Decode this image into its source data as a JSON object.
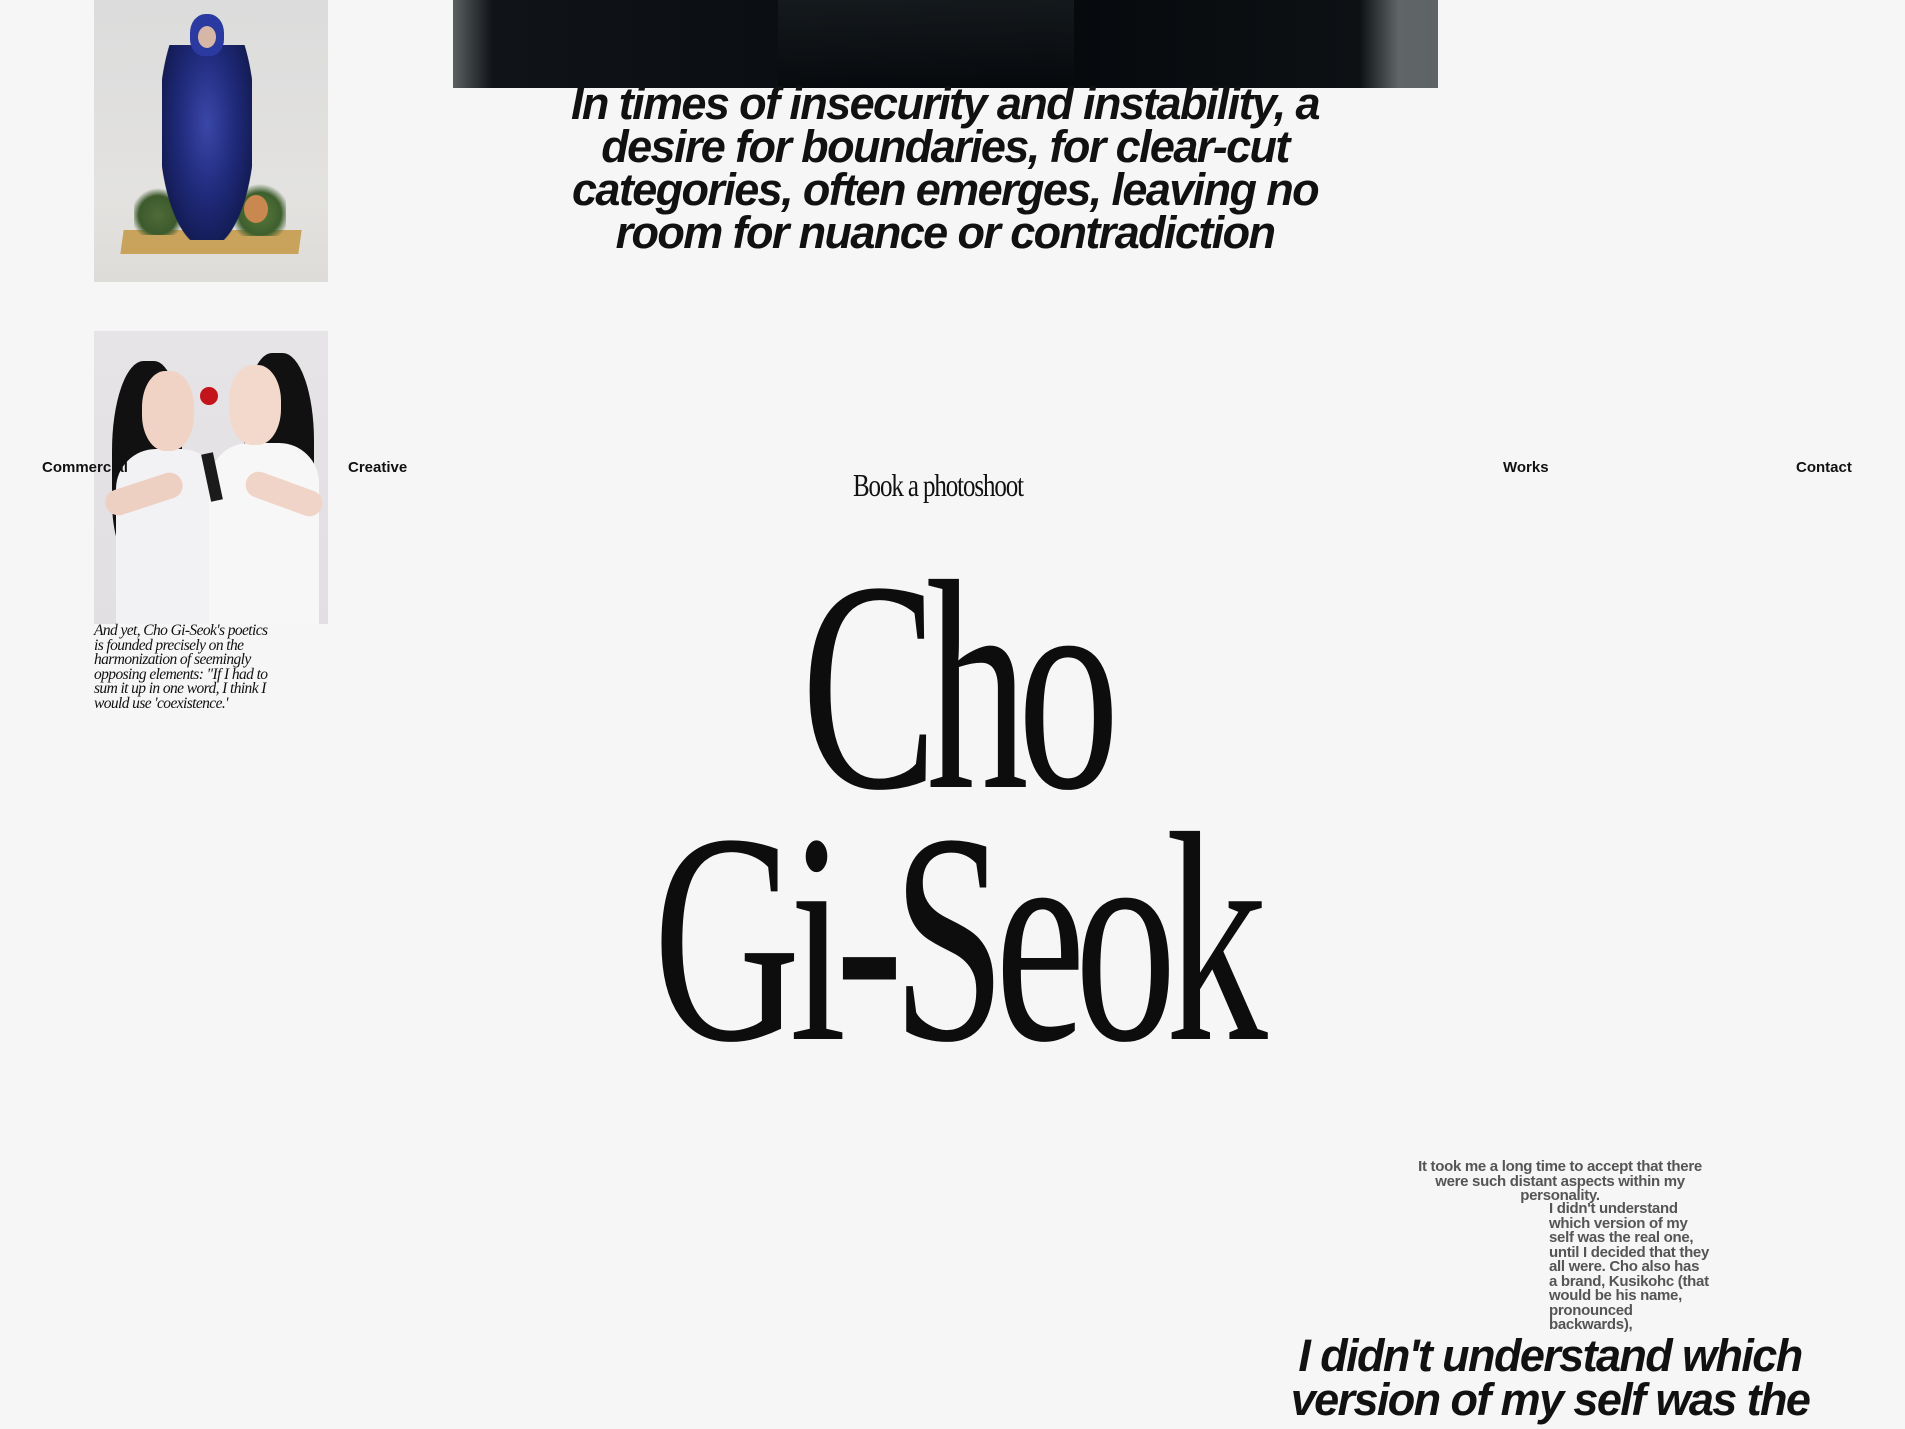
{
  "quotes": {
    "top": "In times of insecurity and instability, a desire for boundaries, for clear-cut categories, often emerges, leaving no room for nuance or contradiction",
    "bottom": "I didn't understand which version of my self was the"
  },
  "nav": {
    "commercial": "Commercial",
    "creative": "Creative",
    "book": "Book a photoshoot",
    "works": "Works",
    "contact": "Contact"
  },
  "captions": {
    "left": "And yet, Cho Gi-Seok's poetics is founded precisely on the harmonization of seemingly opposing elements: \"If I had to sum it up in one word, I think I would use 'coexistence.'",
    "right_a": "It took me a long time to accept that there were such distant aspects within my personality.",
    "right_b": "I didn't understand which version of my self was the real one, until I decided that they all were. Cho also has a brand, Kusikohc (that would be his name, pronounced backwards),"
  },
  "hero": {
    "line1": "Cho",
    "line2": "Gi-Seok"
  },
  "colors": {
    "background": "#f6f6f6",
    "text": "#111111",
    "muted_text": "#555555"
  }
}
